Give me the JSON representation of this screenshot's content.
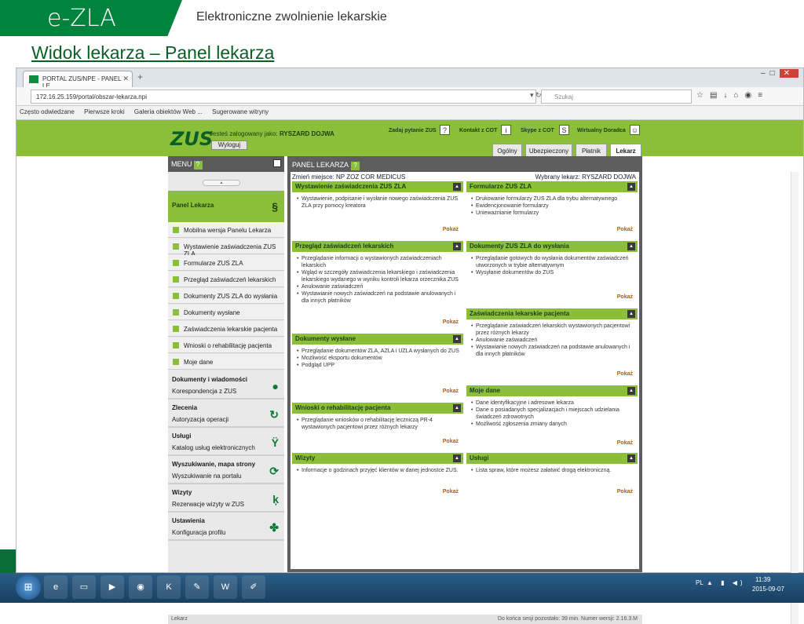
{
  "slide": {
    "brand": "e-ZLA",
    "subtitle": "Elektroniczne zwolnienie lekarskie",
    "title": "Widok lekarza – Panel lekarza"
  },
  "browser": {
    "tab_title": "PORTAL ZUS/NPE - PANEL LE",
    "url": "172.16.25.159/portal/obszar-lekarza.npi",
    "search_placeholder": "Szukaj",
    "bookmarks": [
      "Często odwiedzane",
      "Pierwsze kroki",
      "Galeria obiektów Web ...",
      "Sugerowane witryny"
    ]
  },
  "header": {
    "logo": "ZUS",
    "logged_prefix": "Jesteś zalogowany jako:",
    "user": "RYSZARD DOJWA",
    "logout": "Wyloguj",
    "links": [
      "Zadaj pytanie ZUS",
      "Kontakt z COT",
      "Skype z COT",
      "Wirtualny Doradca"
    ],
    "role_tabs": [
      "Ogólny",
      "Ubezpieczony",
      "Płatnik",
      "Lekarz"
    ],
    "active_role": "Lekarz"
  },
  "menu": {
    "title": "MENU",
    "panel_item": "Panel Lekarza",
    "sub_items": [
      "Mobilna wersja Panelu Lekarza",
      "Wystawienie zaświadczenia ZUS ZLA",
      "Formularze ZUS ZLA",
      "Przegląd zaświadczeń lekarskich",
      "Dokumenty ZUS ZLA do wysłania",
      "Dokumenty wysłane",
      "Zaświadczenia lekarskie pacjenta",
      "Wnioski o rehabilitację pacjenta",
      "Moje dane"
    ],
    "groups": [
      {
        "title": "Dokumenty i wiadomości",
        "desc": "Korespondencja z ZUS",
        "icon": "speech-icon"
      },
      {
        "title": "Zlecenia",
        "desc": "Autoryzacja operacji",
        "icon": "refresh-icon"
      },
      {
        "title": "Usługi",
        "desc": "Katalog usług elektronicznych",
        "icon": "services-icon"
      },
      {
        "title": "Wyszukiwanie, mapa strony",
        "desc": "Wyszukiwanie na portalu",
        "icon": "sync-icon"
      },
      {
        "title": "Wizyty",
        "desc": "Rezerwacje wizyty w ZUS",
        "icon": "walk-icon"
      },
      {
        "title": "Ustawienia",
        "desc": "Konfiguracja profilu",
        "icon": "puzzle-icon"
      }
    ]
  },
  "main": {
    "title": "PANEL LEKARZA",
    "place_label": "Zmień miejsce: NP ZOZ COR MEDICUS",
    "doctor_label": "Wybrany lekarz: RYSZARD DOJWA",
    "more": "Pokaż",
    "cards": [
      {
        "title": "Wystawienie zaświadczenia ZUS ZLA",
        "items": [
          "Wystawienie, podpisanie i wysłanie nowego zaświadczenia ZUS ZLA przy pomocy kreatora"
        ]
      },
      {
        "title": "Formularze ZUS ZLA",
        "items": [
          "Drukowanie formularzy ZUS ZLA dla trybu alternatywnego",
          "Ewidencjonowanie formularzy",
          "Unieważnianie formularzy"
        ]
      },
      {
        "title": "Przegląd zaświadczeń lekarskich",
        "items": [
          "Przeglądanie informacji o wystawionych zaświadczeniach lekarskich",
          "Wgląd w szczegóły zaświadczenia lekarskiego i zaświadczenia lekarskiego wydanego w wyniku kontroli lekarza orzecznika ZUS",
          "Anulowanie zaświadczeń",
          "Wystawianie nowych zaświadczeń na podstawie anulowanych i dla innych płatników"
        ]
      },
      {
        "title": "Dokumenty ZUS ZLA do wysłania",
        "items": [
          "Przeglądanie gotowych do wysłania dokumentów zaświadczeń utworzonych w trybie alternatywnym",
          "Wysyłanie dokumentów do ZUS"
        ]
      },
      {
        "title": "Zaświadczenia lekarskie pacjenta",
        "items": [
          "Przeglądanie zaświadczeń lekarskich wystawionych pacjentowi przez różnych lekarzy",
          "Anulowanie zaświadczeń",
          "Wystawianie nowych zaświadczeń na podstawie anulowanych i dla innych płatników"
        ]
      },
      {
        "title": "Dokumenty wysłane",
        "items": [
          "Przeglądanie dokumentów ZLA, AZLA i UZLA wysłanych do ZUS",
          "Możliwość eksportu dokumentów",
          "Podgląd UPP"
        ]
      },
      {
        "title": "Moje dane",
        "items": [
          "Dane identyfikacyjne i adresowe lekarza",
          "Dane o posiadanych specjalizacjach i miejscach udzielania świadczeń zdrowotnych",
          "Możliwość zgłoszenia zmiany danych"
        ]
      },
      {
        "title": "Wnioski o rehabilitację pacjenta",
        "items": [
          "Przeglądanie wniosków o rehabilitację leczniczą PR-4 wystawionych pacjentowi przez różnych lekarzy"
        ]
      },
      {
        "title": "Wizyty",
        "items": [
          "Informacje o godzinach przyjęć klientów w danej jednostce ZUS."
        ]
      },
      {
        "title": "Usługi",
        "items": [
          "Lista spraw, które możesz załatwić drogą elektroniczną."
        ]
      }
    ],
    "status_left": "Lekarz",
    "status_right": "Do końca sesji pozostało: 39 min.  Numer wersji: 2.16.3.M"
  },
  "taskbar": {
    "lang": "PL",
    "time": "11:39",
    "date": "2015-09-07",
    "apps": [
      "start",
      "ie",
      "explorer",
      "media",
      "firefox",
      "ksi",
      "paint",
      "word",
      "notes"
    ]
  }
}
